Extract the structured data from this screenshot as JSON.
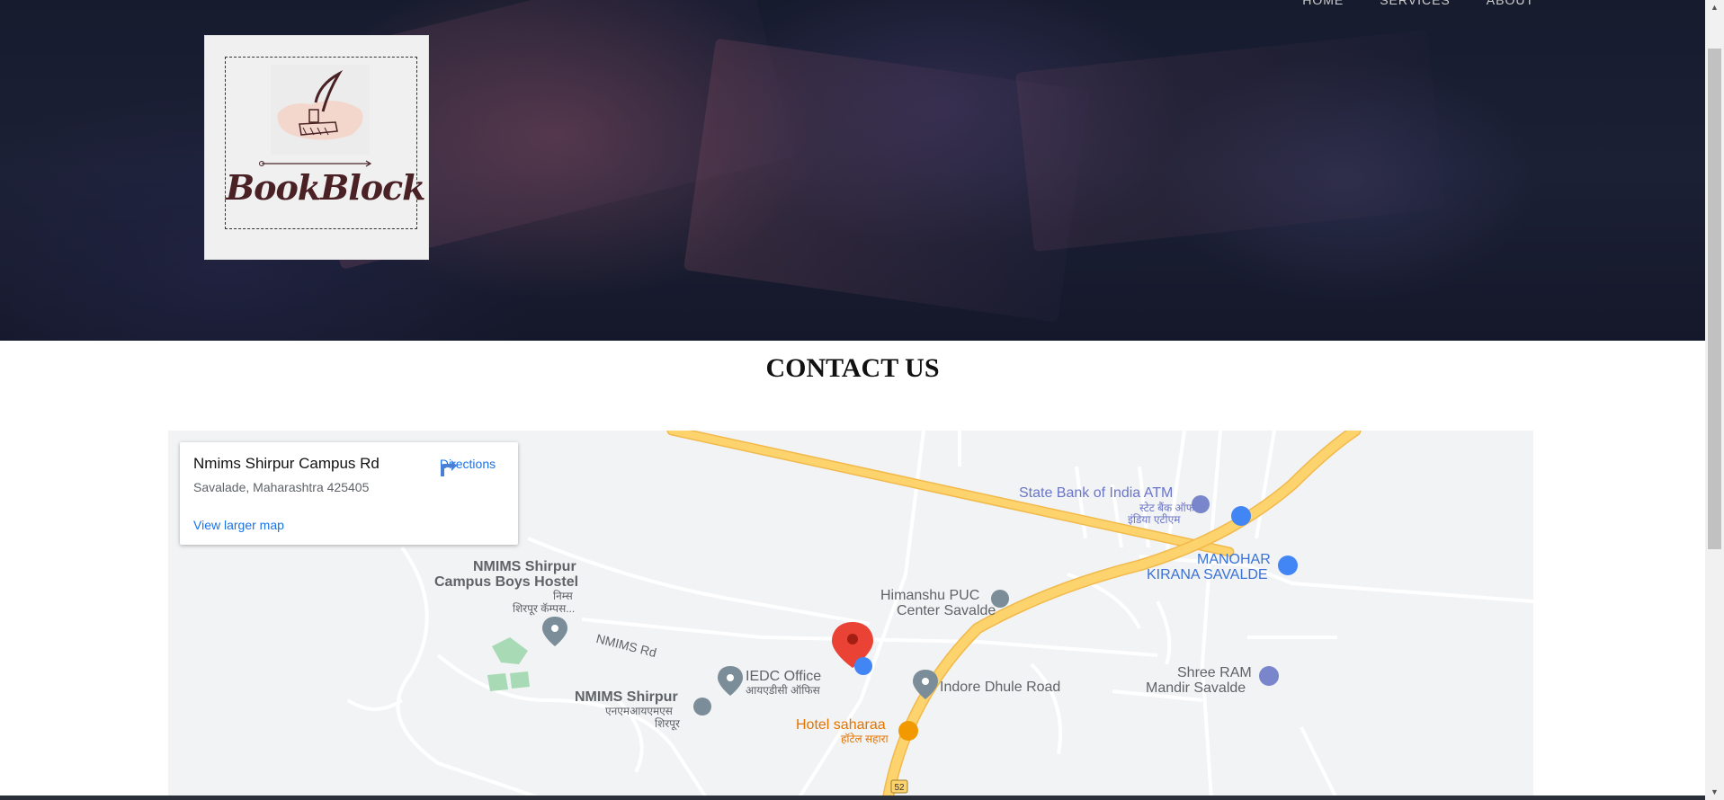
{
  "nav": {
    "items": [
      "HOME",
      "SERVICES",
      "ABOUT"
    ]
  },
  "logo": {
    "text": "BookBlock"
  },
  "contact": {
    "title": "CONTACT US"
  },
  "map": {
    "card": {
      "title": "Nmims Shirpur Campus Rd",
      "address": "Savalade, Maharashtra 425405",
      "view_larger": "View larger map",
      "directions": "Directions"
    },
    "labels": {
      "sbi": "State Bank of India ATM",
      "sbi_hi": "स्टेट बैंक ऑफ",
      "sbi_hi2": "इंडिया एटीएम",
      "manohar": "MANOHAR",
      "manohar2": "KIRANA SAVALDE",
      "hostel": "NMIMS Shirpur",
      "hostel2": "Campus Boys Hostel",
      "hostel_hi": "निम्स",
      "hostel_hi2": "शिरपूर कॅम्पस...",
      "himanshu": "Himanshu PUC",
      "himanshu2": "Center Savalde",
      "nmims_rd": "NMIMS Rd",
      "iedc": "IEDC Office",
      "iedc_hi": "आयएडीसी ऑफिस",
      "indore": "Indore Dhule Road",
      "shree": "Shree RAM",
      "shree2": "Mandir Savalde",
      "nmims": "NMIMS Shirpur",
      "nmims_hi": "एनएमआयएमएस",
      "nmims_hi2": "शिरपूर",
      "hotel": "Hotel saharaa",
      "hotel_hi": "हॉटेल सहारा",
      "route": "52"
    },
    "colors": {
      "major_road": "#fdd36d",
      "road_edge": "#f2b94b",
      "minor_road": "#ffffff",
      "background": "#f1f3f4",
      "park": "#a8dab5"
    }
  }
}
